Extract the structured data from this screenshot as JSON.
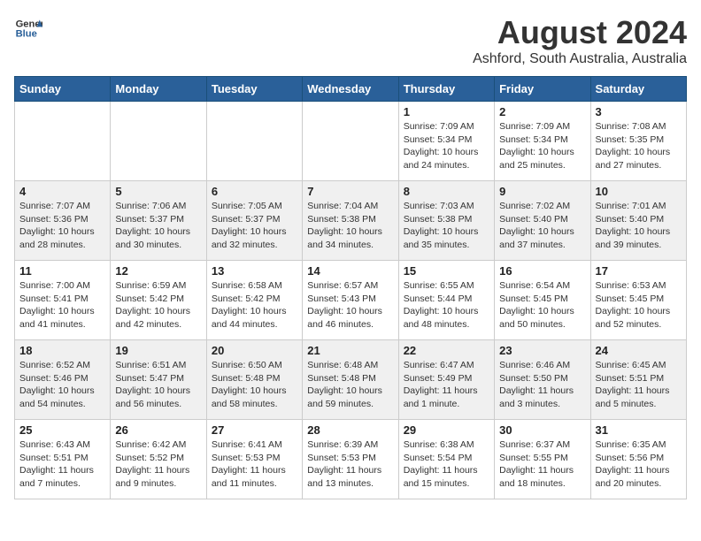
{
  "header": {
    "logo_general": "General",
    "logo_blue": "Blue",
    "title": "August 2024",
    "subtitle": "Ashford, South Australia, Australia"
  },
  "days_of_week": [
    "Sunday",
    "Monday",
    "Tuesday",
    "Wednesday",
    "Thursday",
    "Friday",
    "Saturday"
  ],
  "weeks": [
    [
      {
        "day": "",
        "info": ""
      },
      {
        "day": "",
        "info": ""
      },
      {
        "day": "",
        "info": ""
      },
      {
        "day": "",
        "info": ""
      },
      {
        "day": "1",
        "info": "Sunrise: 7:09 AM\nSunset: 5:34 PM\nDaylight: 10 hours\nand 24 minutes."
      },
      {
        "day": "2",
        "info": "Sunrise: 7:09 AM\nSunset: 5:34 PM\nDaylight: 10 hours\nand 25 minutes."
      },
      {
        "day": "3",
        "info": "Sunrise: 7:08 AM\nSunset: 5:35 PM\nDaylight: 10 hours\nand 27 minutes."
      }
    ],
    [
      {
        "day": "4",
        "info": "Sunrise: 7:07 AM\nSunset: 5:36 PM\nDaylight: 10 hours\nand 28 minutes."
      },
      {
        "day": "5",
        "info": "Sunrise: 7:06 AM\nSunset: 5:37 PM\nDaylight: 10 hours\nand 30 minutes."
      },
      {
        "day": "6",
        "info": "Sunrise: 7:05 AM\nSunset: 5:37 PM\nDaylight: 10 hours\nand 32 minutes."
      },
      {
        "day": "7",
        "info": "Sunrise: 7:04 AM\nSunset: 5:38 PM\nDaylight: 10 hours\nand 34 minutes."
      },
      {
        "day": "8",
        "info": "Sunrise: 7:03 AM\nSunset: 5:38 PM\nDaylight: 10 hours\nand 35 minutes."
      },
      {
        "day": "9",
        "info": "Sunrise: 7:02 AM\nSunset: 5:40 PM\nDaylight: 10 hours\nand 37 minutes."
      },
      {
        "day": "10",
        "info": "Sunrise: 7:01 AM\nSunset: 5:40 PM\nDaylight: 10 hours\nand 39 minutes."
      }
    ],
    [
      {
        "day": "11",
        "info": "Sunrise: 7:00 AM\nSunset: 5:41 PM\nDaylight: 10 hours\nand 41 minutes."
      },
      {
        "day": "12",
        "info": "Sunrise: 6:59 AM\nSunset: 5:42 PM\nDaylight: 10 hours\nand 42 minutes."
      },
      {
        "day": "13",
        "info": "Sunrise: 6:58 AM\nSunset: 5:42 PM\nDaylight: 10 hours\nand 44 minutes."
      },
      {
        "day": "14",
        "info": "Sunrise: 6:57 AM\nSunset: 5:43 PM\nDaylight: 10 hours\nand 46 minutes."
      },
      {
        "day": "15",
        "info": "Sunrise: 6:55 AM\nSunset: 5:44 PM\nDaylight: 10 hours\nand 48 minutes."
      },
      {
        "day": "16",
        "info": "Sunrise: 6:54 AM\nSunset: 5:45 PM\nDaylight: 10 hours\nand 50 minutes."
      },
      {
        "day": "17",
        "info": "Sunrise: 6:53 AM\nSunset: 5:45 PM\nDaylight: 10 hours\nand 52 minutes."
      }
    ],
    [
      {
        "day": "18",
        "info": "Sunrise: 6:52 AM\nSunset: 5:46 PM\nDaylight: 10 hours\nand 54 minutes."
      },
      {
        "day": "19",
        "info": "Sunrise: 6:51 AM\nSunset: 5:47 PM\nDaylight: 10 hours\nand 56 minutes."
      },
      {
        "day": "20",
        "info": "Sunrise: 6:50 AM\nSunset: 5:48 PM\nDaylight: 10 hours\nand 58 minutes."
      },
      {
        "day": "21",
        "info": "Sunrise: 6:48 AM\nSunset: 5:48 PM\nDaylight: 10 hours\nand 59 minutes."
      },
      {
        "day": "22",
        "info": "Sunrise: 6:47 AM\nSunset: 5:49 PM\nDaylight: 11 hours\nand 1 minute."
      },
      {
        "day": "23",
        "info": "Sunrise: 6:46 AM\nSunset: 5:50 PM\nDaylight: 11 hours\nand 3 minutes."
      },
      {
        "day": "24",
        "info": "Sunrise: 6:45 AM\nSunset: 5:51 PM\nDaylight: 11 hours\nand 5 minutes."
      }
    ],
    [
      {
        "day": "25",
        "info": "Sunrise: 6:43 AM\nSunset: 5:51 PM\nDaylight: 11 hours\nand 7 minutes."
      },
      {
        "day": "26",
        "info": "Sunrise: 6:42 AM\nSunset: 5:52 PM\nDaylight: 11 hours\nand 9 minutes."
      },
      {
        "day": "27",
        "info": "Sunrise: 6:41 AM\nSunset: 5:53 PM\nDaylight: 11 hours\nand 11 minutes."
      },
      {
        "day": "28",
        "info": "Sunrise: 6:39 AM\nSunset: 5:53 PM\nDaylight: 11 hours\nand 13 minutes."
      },
      {
        "day": "29",
        "info": "Sunrise: 6:38 AM\nSunset: 5:54 PM\nDaylight: 11 hours\nand 15 minutes."
      },
      {
        "day": "30",
        "info": "Sunrise: 6:37 AM\nSunset: 5:55 PM\nDaylight: 11 hours\nand 18 minutes."
      },
      {
        "day": "31",
        "info": "Sunrise: 6:35 AM\nSunset: 5:56 PM\nDaylight: 11 hours\nand 20 minutes."
      }
    ]
  ]
}
